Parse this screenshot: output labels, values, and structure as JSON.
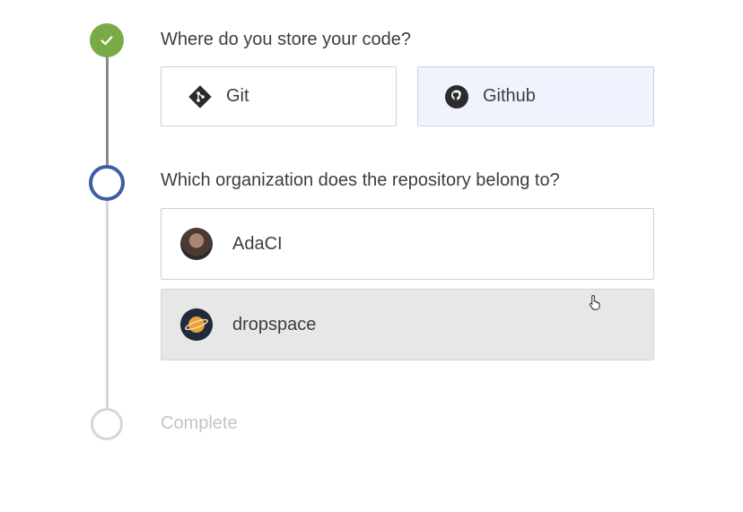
{
  "steps": {
    "step1": {
      "question": "Where do you store your code?",
      "options": [
        {
          "label": "Git",
          "icon": "git-icon",
          "selected": false
        },
        {
          "label": "Github",
          "icon": "github-icon",
          "selected": true
        }
      ],
      "status": "done"
    },
    "step2": {
      "question": "Which organization does the repository belong to?",
      "options": [
        {
          "label": "AdaCI",
          "icon": "adaci-avatar",
          "highlighted": false
        },
        {
          "label": "dropspace",
          "icon": "dropspace-avatar",
          "highlighted": true
        }
      ],
      "status": "active"
    },
    "step3": {
      "label": "Complete",
      "status": "pending"
    }
  },
  "colors": {
    "done": "#78ab46",
    "active": "#3a5fa8",
    "pending": "#d6d6d6",
    "selected_bg": "#eef3fd",
    "hover_bg": "#e7e7e7"
  }
}
